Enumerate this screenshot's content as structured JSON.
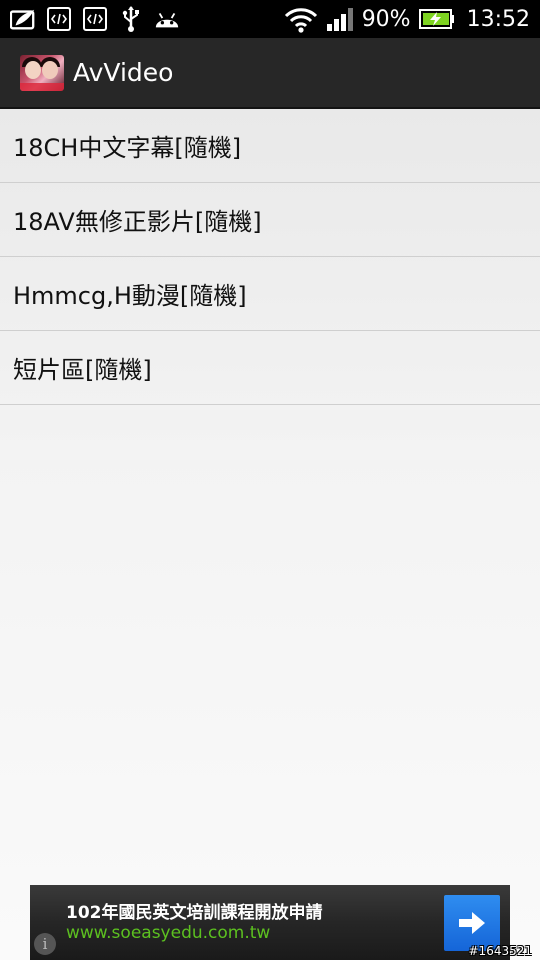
{
  "status_bar": {
    "left_icons": [
      "leaf-icon",
      "code-icon",
      "code-icon",
      "usb-icon",
      "android-icon"
    ],
    "right_icons": [
      "wifi-icon",
      "signal-icon",
      "battery-charging-icon"
    ],
    "battery_percent": "90%",
    "time": "13:52"
  },
  "action_bar": {
    "icon": "app-icon",
    "title": "AvVideo"
  },
  "list": {
    "items": [
      {
        "label": "18CH中文字幕[隨機]"
      },
      {
        "label": "18AV無修正影片[隨機]"
      },
      {
        "label": "Hmmcg,H動漫[隨機]"
      },
      {
        "label": "短片區[隨機]"
      }
    ]
  },
  "ad": {
    "title": "102年國民英文培訓課程開放申請",
    "url": "www.soeasyedu.com.tw",
    "info_icon": "info-icon",
    "button_icon": "arrow-right-icon"
  },
  "watermark": "#1643521",
  "colors": {
    "status_bar_bg": "#000000",
    "action_bar_bg": "#272727",
    "list_bg": "#efefef",
    "divider": "#cfcfcf",
    "ad_url": "#5cc020",
    "ad_button": "#1e78e8",
    "battery_fill": "#7ed321"
  }
}
